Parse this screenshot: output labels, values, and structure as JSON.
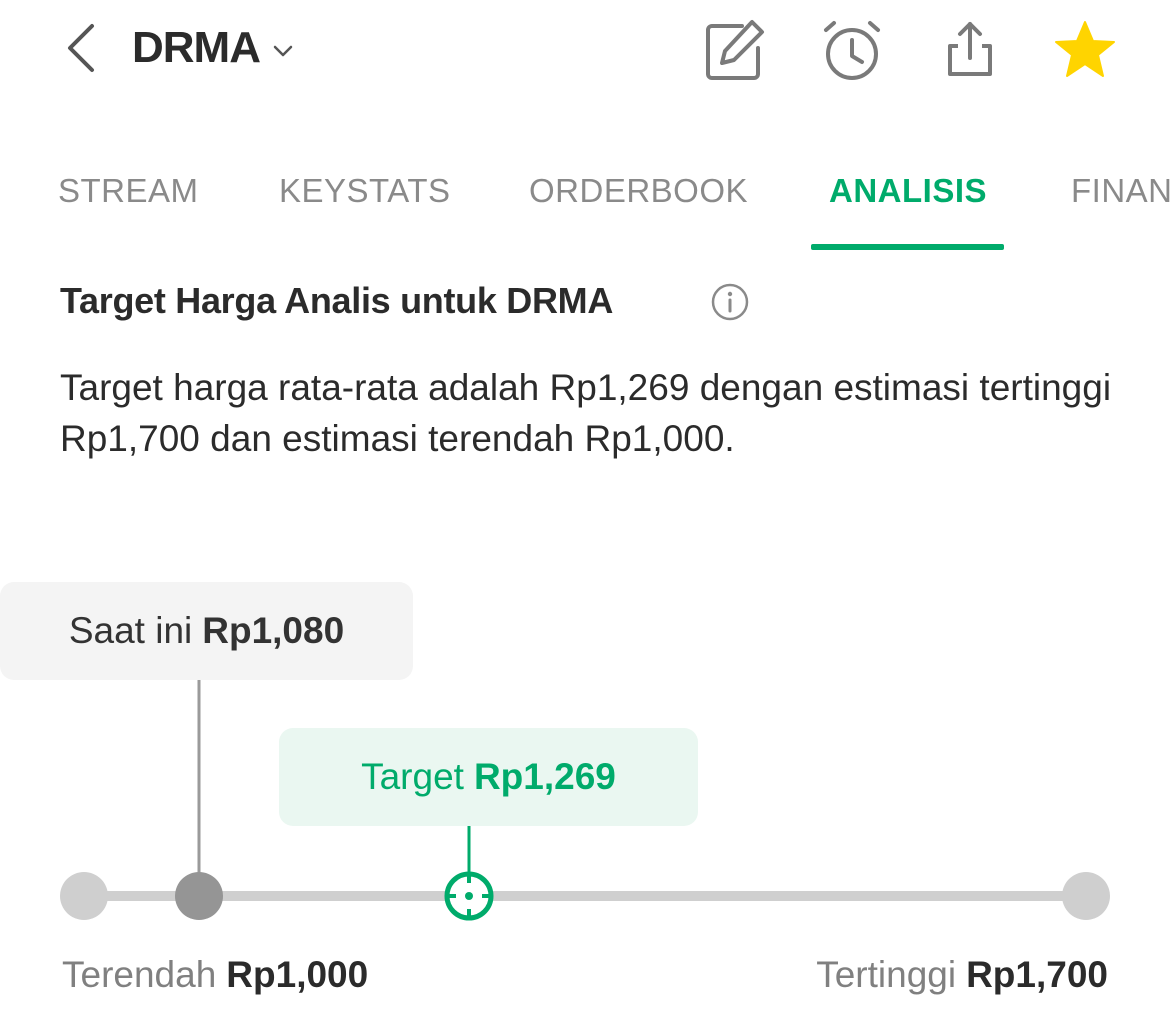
{
  "header": {
    "title": "DRMA",
    "icons": [
      "back-chevron-icon",
      "caret-down-icon",
      "edit-icon",
      "alarm-icon",
      "share-icon",
      "star-icon"
    ],
    "star_color": "#FFD400"
  },
  "tabs": [
    {
      "label": "STREAM",
      "active": false
    },
    {
      "label": "KEYSTATS",
      "active": false
    },
    {
      "label": "ORDERBOOK",
      "active": false
    },
    {
      "label": "ANALISIS",
      "active": true
    },
    {
      "label": "FINAN",
      "active": false
    }
  ],
  "section": {
    "title": "Target Harga Analis untuk DRMA",
    "description": "Target harga rata-rata adalah Rp1,269 dengan estimasi tertinggi Rp1,700 dan estimasi terendah Rp1,000."
  },
  "price_range": {
    "current_prefix": "Saat ini",
    "current_value": "Rp1,080",
    "target_prefix": "Target",
    "target_value": "Rp1,269",
    "low_prefix": "Terendah",
    "low_value": "Rp1,000",
    "high_prefix": "Tertinggi",
    "high_value": "Rp1,700"
  },
  "chart_data": {
    "type": "range",
    "min": 1000,
    "max": 1700,
    "current": 1080,
    "target": 1269
  },
  "colors": {
    "accent": "#00AB6B",
    "track": "#CFCFCF",
    "current_marker": "#959595"
  }
}
